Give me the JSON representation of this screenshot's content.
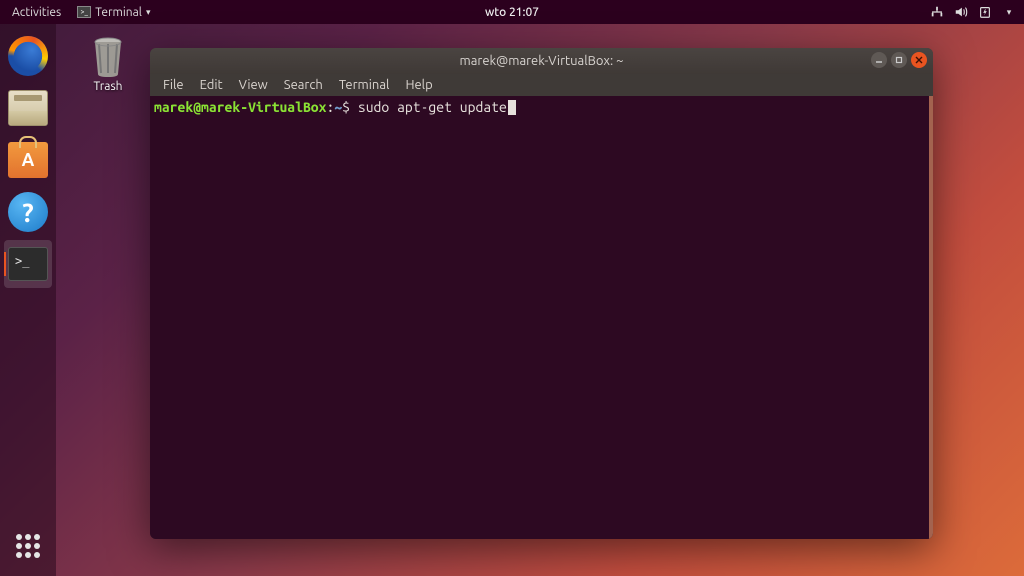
{
  "topbar": {
    "activities": "Activities",
    "app_name": "Terminal",
    "clock": "wto 21:07"
  },
  "desktop": {
    "trash_label": "Trash"
  },
  "dock": {
    "firefox": "firefox",
    "files": "files",
    "software": "software",
    "help": "help",
    "terminal": "terminal",
    "apps": "show-applications"
  },
  "terminal": {
    "title": "marek@marek-VirtualBox: ~",
    "menubar": [
      "File",
      "Edit",
      "View",
      "Search",
      "Terminal",
      "Help"
    ],
    "prompt_user_host": "marek@marek-VirtualBox",
    "prompt_sep": ":",
    "prompt_path": "~",
    "prompt_symbol": "$",
    "command": "sudo apt-get update"
  }
}
